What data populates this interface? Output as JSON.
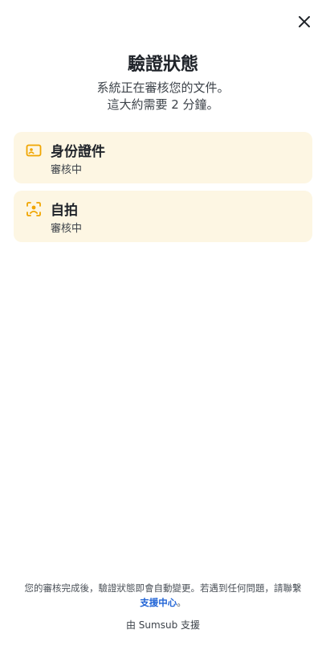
{
  "header": {
    "title": "驗證狀態",
    "subtitle_line1": "系統正在審核您的文件。",
    "subtitle_line2": "這大約需要 2 分鐘。"
  },
  "cards": [
    {
      "title": "身份證件",
      "status": "審核中",
      "icon": "id-card-icon"
    },
    {
      "title": "自拍",
      "status": "審核中",
      "icon": "face-scan-icon"
    }
  ],
  "footer": {
    "note_text": "您的審核完成後，驗證狀態即會自動變更。若遇到任何問題，請聯繫",
    "support_link": "支援中心",
    "note_end": "。",
    "powered_by": "由 Sumsub 支援"
  },
  "colors": {
    "accent": "#f0a500",
    "card_bg": "#fdf6e3",
    "link": "#1f63d6"
  }
}
